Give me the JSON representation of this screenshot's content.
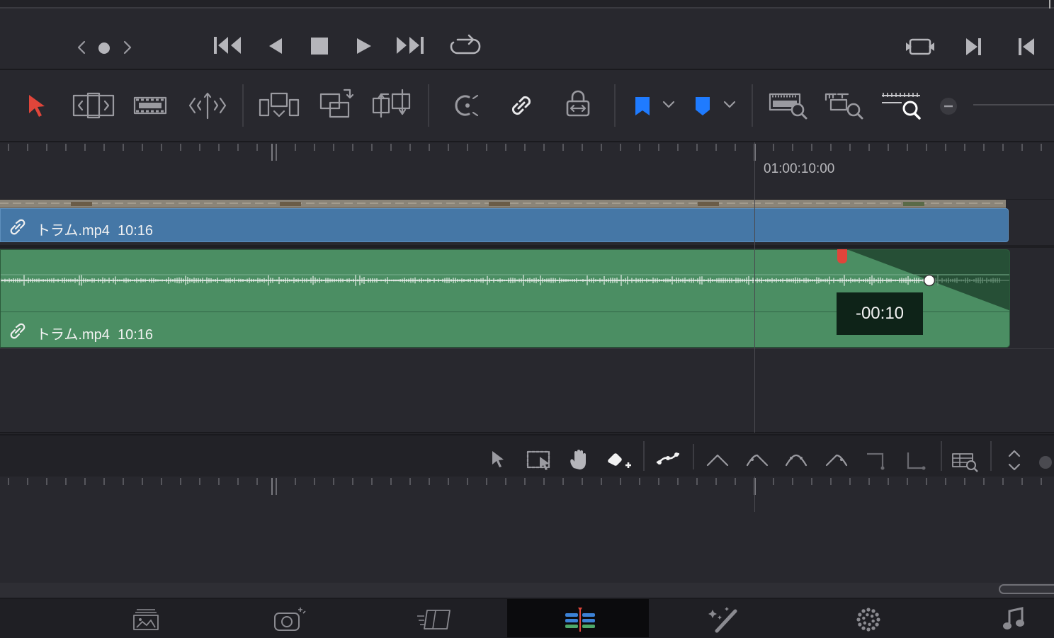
{
  "timeline": {
    "ruler_timecode": "01:00:10:00",
    "video_clip": {
      "name": "トラム.mp4",
      "duration": "10:16"
    },
    "audio_clip": {
      "name": "トラム.mp4",
      "duration": "10:16"
    },
    "fade_tooltip": "-00:10"
  },
  "icons": {
    "transport": [
      "prev-clip-icon",
      "dot-icon",
      "next-clip-icon",
      "jump-to-start-icon",
      "reverse-play-icon",
      "stop-icon",
      "play-icon",
      "jump-to-end-icon",
      "loop-icon",
      "match-frame-icon",
      "next-edit-icon",
      "prev-edit-icon"
    ],
    "toolbar": [
      "selection-pointer-icon",
      "trim-edit-icon",
      "dynamic-trim-icon",
      "blade-icon",
      "insert-clip-icon",
      "overwrite-clip-icon",
      "replace-clip-icon",
      "snapping-icon",
      "linked-selection-icon",
      "position-lock-icon",
      "flag-icon",
      "marker-icon",
      "zoom-full-icon",
      "zoom-detail-icon",
      "zoom-custom-icon",
      "zoom-out-icon"
    ],
    "keyframe_toolbar": [
      "pointer-icon",
      "marquee-icon",
      "hand-icon",
      "add-keyframe-icon",
      "curve-icon",
      "linear-icon",
      "ease-in-icon",
      "ease-in-out-icon",
      "ease-out-icon",
      "hold-icon",
      "step-icon",
      "zoom-graph-icon",
      "expand-icon"
    ],
    "pages": [
      "media-page-icon",
      "cut-page-icon",
      "edit-page-icon",
      "fusion-page-icon",
      "color-page-icon",
      "fairlight-page-icon",
      "deliver-page-icon"
    ]
  },
  "colors": {
    "video_clip": "#4577a6",
    "audio_clip": "#4b8e63",
    "flag": "#1f7bff",
    "marker": "#1f7bff",
    "pointer_active": "#e0453a",
    "fade_handle_marker": "#e0453a"
  }
}
